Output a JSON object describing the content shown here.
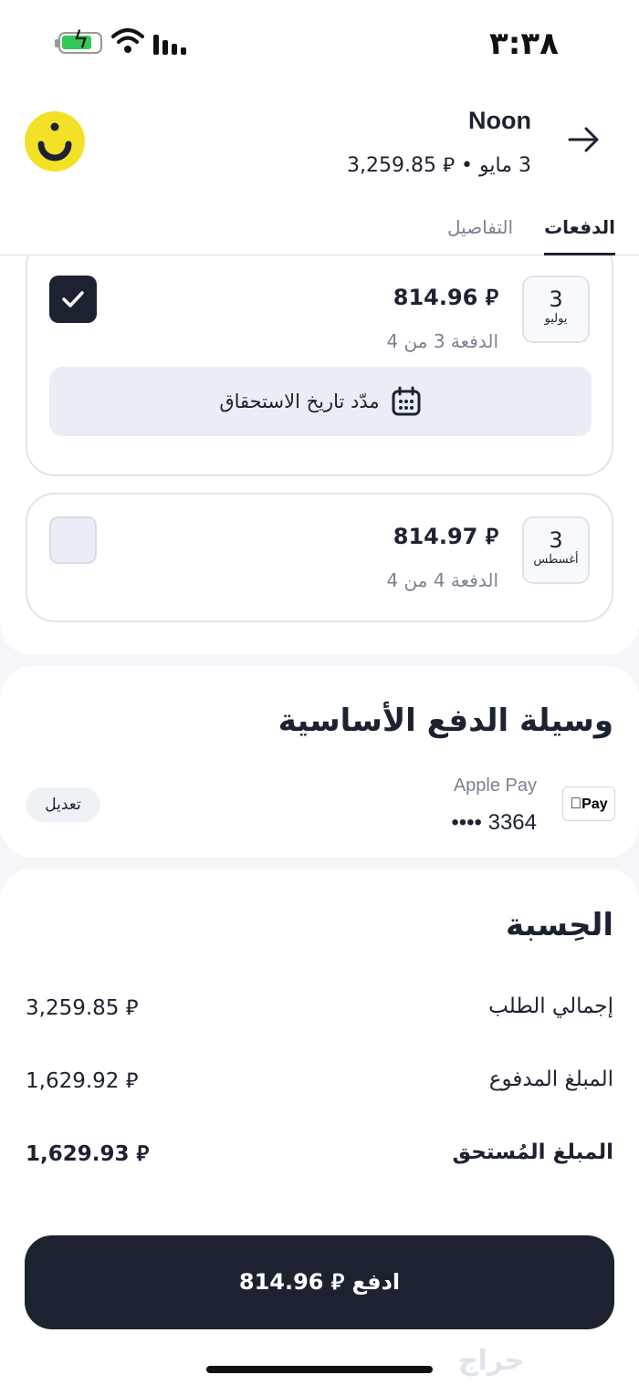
{
  "status_bar": {
    "time": "٣:٣٨"
  },
  "header": {
    "merchant_name": "Noon",
    "subtitle": "3 مايو • ⃁ 3,259.85",
    "tabs": [
      {
        "label": "الدفعات",
        "active": true
      },
      {
        "label": "التفاصيل",
        "active": false
      }
    ]
  },
  "installments": [
    {
      "day": "3",
      "month": "يوليو",
      "amount": "⃁ 814.96",
      "label": "الدفعة 3 من 4",
      "checked": true
    },
    {
      "day": "3",
      "month": "أغسطس",
      "amount": "⃁ 814.97",
      "label": "الدفعة 4 من 4",
      "checked": false
    }
  ],
  "extend_due_date_label": "مدّد تاريخ الاستحقاق",
  "payment_method": {
    "title": "وسيلة الدفع الأساسية",
    "badge": "Pay",
    "name": "Apple Pay",
    "masked_number": "•••• 3364",
    "edit_label": "تعديل"
  },
  "summary": {
    "title": "الحِسبة",
    "rows": [
      {
        "label": "إجمالي الطلب",
        "value": "⃁ 3,259.85"
      },
      {
        "label": "المبلغ المدفوع",
        "value": "⃁ 1,629.92"
      },
      {
        "label": "المبلغ المُستحق",
        "value": "⃁ 1,629.93"
      }
    ]
  },
  "pay_button_label": "ادفع ⃁ 814.96",
  "watermark": "حراج",
  "colors": {
    "primary": "#1c2230",
    "noon_yellow": "#f3e127",
    "muted": "#7a8190",
    "surface": "#e9eef6"
  }
}
